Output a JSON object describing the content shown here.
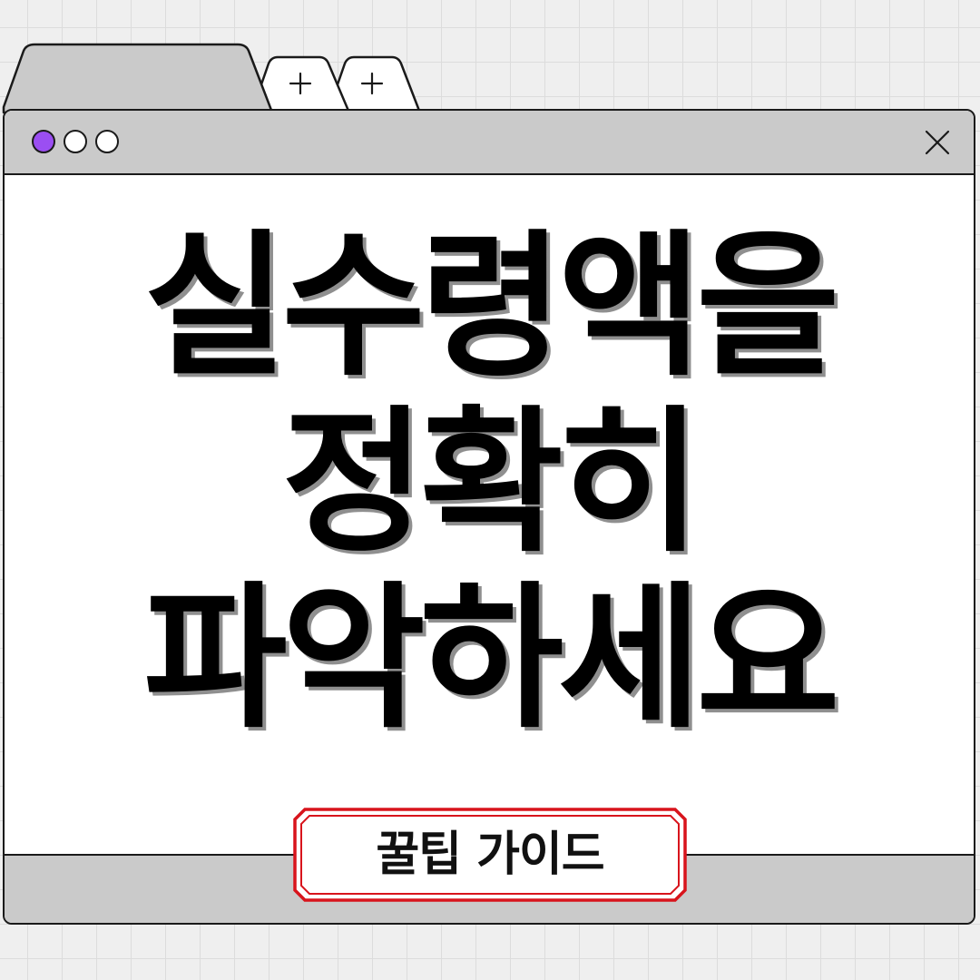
{
  "browser": {
    "tabs": [
      {
        "id": "active-tab"
      },
      {
        "id": "new-tab-1",
        "icon": "plus-icon"
      },
      {
        "id": "new-tab-2",
        "icon": "plus-icon"
      }
    ],
    "window_controls": {
      "dot_colors": [
        "#9b4ef2",
        "#ffffff",
        "#ffffff"
      ],
      "close_icon": "close-icon"
    }
  },
  "headline": {
    "lines": [
      "실수령액을",
      "정확히",
      "파악하세요"
    ]
  },
  "badge": {
    "label": "꿀팁 가이드",
    "border_color": "#d8141c"
  },
  "colors": {
    "background": "#efefef",
    "grid_line": "#dcdcdc",
    "chrome": "#cacaca",
    "window": "#ffffff",
    "outline": "#1a1a1a",
    "text": "#000000",
    "text_shadow": "#8f8f8f",
    "accent": "#9b4ef2"
  }
}
